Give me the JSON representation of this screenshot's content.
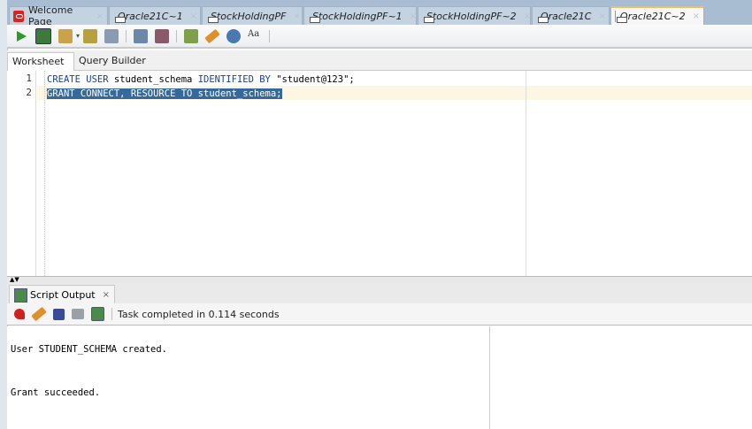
{
  "doc_tabs": [
    {
      "label": "Welcome Page",
      "icon": "oracle-icon"
    },
    {
      "label": "Oracle21C~1",
      "icon": "sql-worksheet-icon"
    },
    {
      "label": "StockHoldingPF",
      "icon": "sql-worksheet-icon"
    },
    {
      "label": "StockHoldingPF~1",
      "icon": "sql-worksheet-icon"
    },
    {
      "label": "StockHoldingPF~2",
      "icon": "sql-worksheet-icon"
    },
    {
      "label": "Oracle21C",
      "icon": "sql-worksheet-icon"
    },
    {
      "label": "Oracle21C~2",
      "icon": "sql-worksheet-icon",
      "active": true
    }
  ],
  "close_glyph": "×",
  "worksheet_tabs": {
    "worksheet": "Worksheet",
    "query_builder": "Query Builder"
  },
  "editor": {
    "line_numbers": [
      "1",
      "2"
    ],
    "line1": {
      "kw1": "CREATE USER",
      "t1": " student_schema ",
      "kw2": "IDENTIFIED BY",
      "t2": " \"student@123\";"
    },
    "line2": "GRANT CONNECT, RESOURCE TO student_schema;"
  },
  "output": {
    "tab_label": "Script Output",
    "status": "Task completed in 0.114 seconds",
    "lines": [
      "User STUDENT_SCHEMA created.",
      "Grant succeeded."
    ]
  },
  "colors": {
    "selection": "#35689b",
    "keyword": "#1a3f9a",
    "tabbar": "#a9bdd2"
  }
}
